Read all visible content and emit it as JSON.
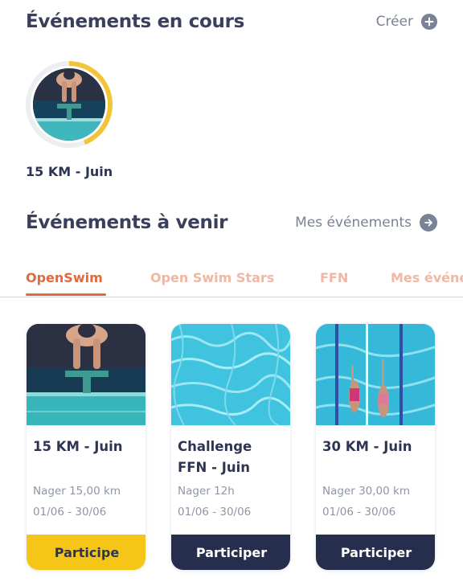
{
  "current": {
    "title": "Événements en cours",
    "action_label": "Créer",
    "action_icon": "plus-circle-icon",
    "event": {
      "label": "15 KM - Juin",
      "progress": 0.44,
      "accent": "#f2c43a"
    }
  },
  "upcoming": {
    "title": "Événements à venir",
    "action_label": "Mes événements",
    "action_icon": "arrow-right-circle-icon"
  },
  "tabs": [
    "OpenSwim",
    "Open Swim Stars",
    "FFN",
    "Mes événe"
  ],
  "active_tab": "OpenSwim",
  "cards": [
    {
      "title": "15 KM - Juin",
      "goal": "Nager 15,00 km",
      "dates": "01/06 - 30/06",
      "button": "Participe",
      "state": "joined"
    },
    {
      "title": "Challenge FFN - Juin",
      "goal": "Nager 12h",
      "dates": "01/06 - 30/06",
      "button": "Participer",
      "state": "open"
    },
    {
      "title": "30 KM - Juin",
      "goal": "Nager 30,00 km",
      "dates": "01/06 - 30/06",
      "button": "Participer",
      "state": "open"
    }
  ],
  "colors": {
    "accent": "#e2683e",
    "accent_light": "#f0b7a3",
    "navy": "#262e4e",
    "yellow": "#f5c518",
    "icon_grey": "#7a8295"
  }
}
